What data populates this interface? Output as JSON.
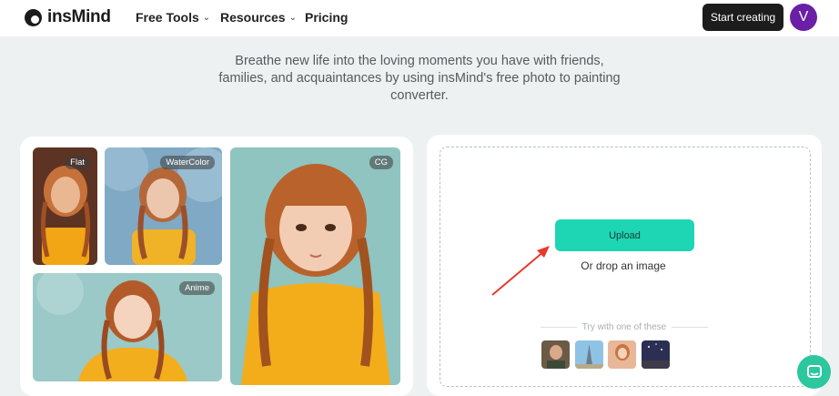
{
  "header": {
    "logo_text": "insMind",
    "nav": [
      {
        "label": "Free Tools",
        "has_dropdown": true
      },
      {
        "label": "Resources",
        "has_dropdown": true
      },
      {
        "label": "Pricing",
        "has_dropdown": false
      }
    ],
    "cta_label": "Start creating",
    "avatar_initial": "V",
    "avatar_color": "#6a1fa6"
  },
  "intro": {
    "text": "Breathe new life into the loving moments you have with friends, families, and acquaintances by using insMind's free photo to painting converter."
  },
  "showcase": {
    "styles": [
      "Flat",
      "WaterColor",
      "CG",
      "Anime"
    ]
  },
  "upload": {
    "button_label": "Upload",
    "drop_text": "Or drop an image",
    "try_text": "Try with one of these",
    "sample_icons": [
      "sample-portrait-icon",
      "sample-tower-icon",
      "sample-woman-icon",
      "sample-night-icon"
    ],
    "accent_color": "#1ed5b4"
  },
  "chat": {
    "icon": "chat-icon",
    "color": "#2cc79f"
  }
}
